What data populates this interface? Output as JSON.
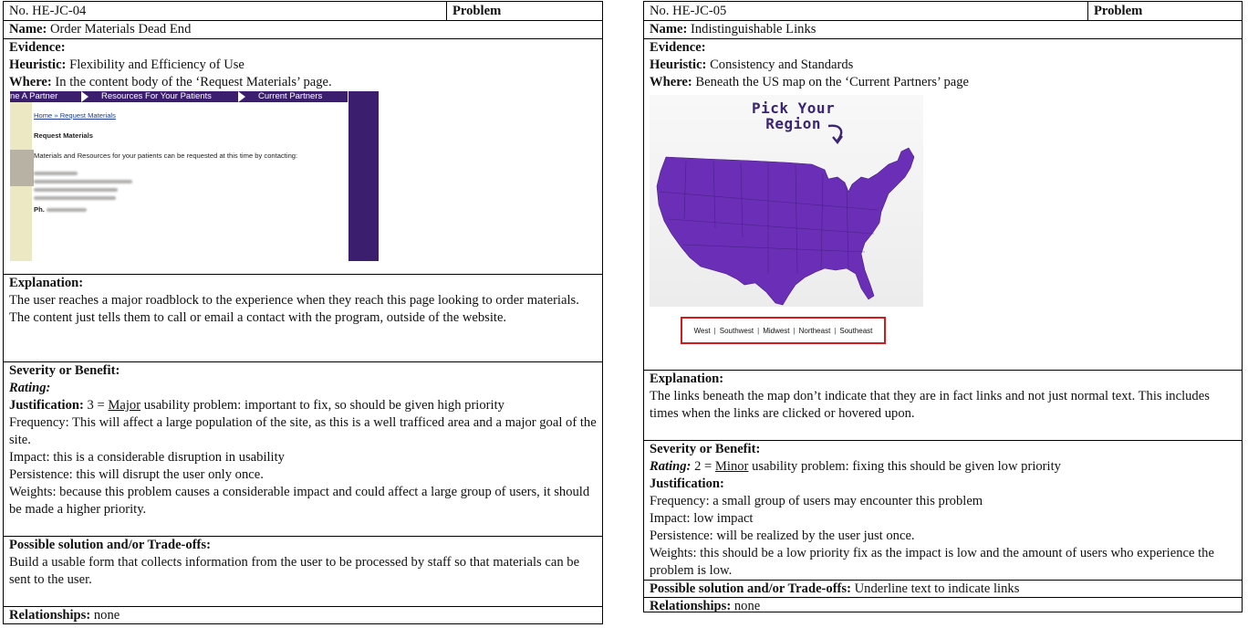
{
  "card1": {
    "number": "No. HE-JC-04",
    "problem_label": "Problem",
    "name_label": "Name:",
    "name": "Order Materials Dead End",
    "evidence_label": "Evidence:",
    "heuristic_label": "Heuristic:",
    "heuristic": "Flexibility and Efficiency of Use",
    "where_label": "Where:",
    "where": "In the content body of the ‘Request Materials’ page.",
    "screenshot": {
      "nav_tabs": [
        "ne A Partner",
        "Resources For Your Patients",
        "Current Partners"
      ],
      "breadcrumb": "Home » Request Materials",
      "heading": "Request Materials",
      "body": "Materials and Resources for your patients can be requested at this time by contacting:",
      "phone_prefix": "Ph."
    },
    "explanation_label": "Explanation:",
    "explanation": "The user reaches a major roadblock to the experience when they reach this page looking to order materials. The content just tells them to call or email a contact with the program, outside of the website.",
    "severity_label": "Severity or Benefit:",
    "rating_label": "Rating:",
    "justification_label": "Justification:",
    "justification_prefix": "3 =",
    "justification_term": "Major",
    "justification_rest": "usability problem: important to fix, so should be given high priority",
    "frequency": "Frequency: This will affect a large population of the site, as this is a well trafficed area and a major goal of the site.",
    "impact": "Impact: this is a considerable disruption in usability",
    "persistence": "Persistence: this will disrupt the user only once.",
    "weights": "Weights: because this problem causes a considerable impact and could affect a large group of users, it should be made a higher priority.",
    "solution_label": "Possible solution and/or Trade-offs:",
    "solution": "Build a usable form that collects information from the user to be processed by staff so that materials can be sent to the user.",
    "relationships_label": "Relationships:",
    "relationships": "none"
  },
  "card2": {
    "number": "No. HE-JC-05",
    "problem_label": "Problem",
    "name_label": "Name:",
    "name": "Indistinguishable Links",
    "evidence_label": "Evidence:",
    "heuristic_label": "Heuristic:",
    "heuristic": "Consistency and Standards",
    "where_label": "Where:",
    "where": "Beneath the US map on the ‘Current Partners’ page",
    "map": {
      "pick_line1": "Pick Your",
      "pick_line2": "Region",
      "map_fill": "#6a2fb6",
      "links": [
        "West",
        "Southwest",
        "Midwest",
        "Northeast",
        "Southeast"
      ],
      "highlight_color": "#d7191c"
    },
    "explanation_label": "Explanation:",
    "explanation": "The links beneath the map don’t indicate that they are in fact links and not just normal text. This includes times when the links are clicked or hovered upon.",
    "severity_label": "Severity or Benefit:",
    "rating_label": "Rating:",
    "rating_prefix": "2 =",
    "rating_term": "Minor",
    "rating_rest": "usability problem: fixing this should be given low priority",
    "justification_label": "Justification:",
    "frequency": "Frequency: a small group of users may encounter this problem",
    "impact": "Impact: low impact",
    "persistence": "Persistence: will be realized by the user just once.",
    "weights": "Weights: this should be a low priority fix as the impact is low and the amount of users who experience the problem is low.",
    "solution_label": "Possible solution and/or Trade-offs:",
    "solution": "Underline text to indicate links",
    "relationships_label": "Relationships:",
    "relationships": "none"
  }
}
